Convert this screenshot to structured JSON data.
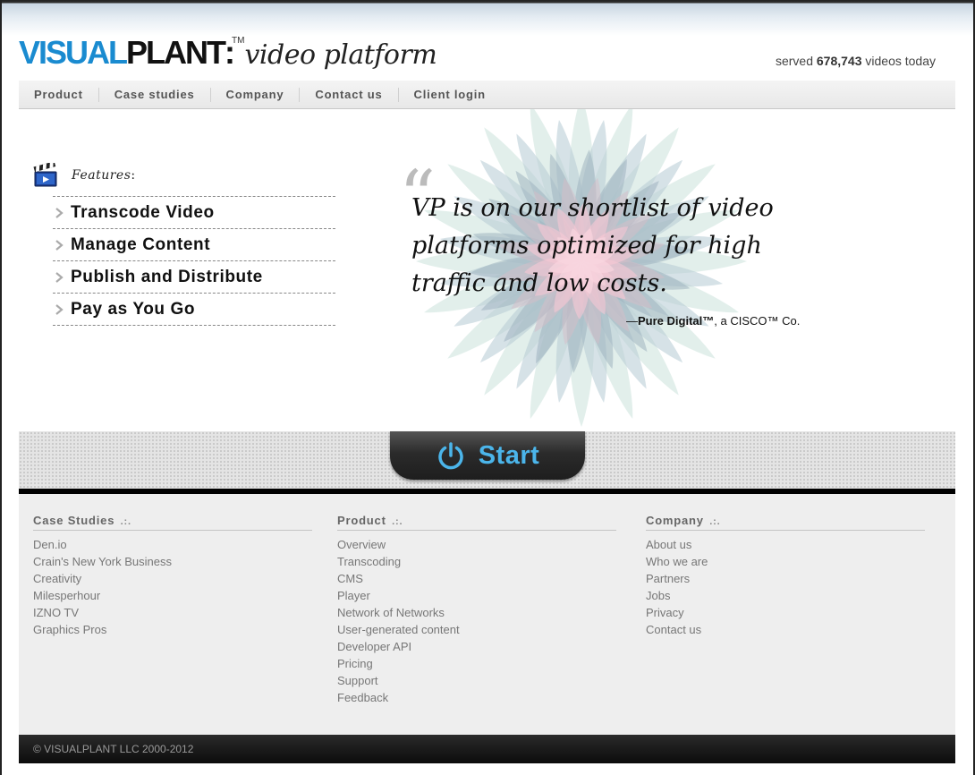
{
  "brand": {
    "visual": "VISUAL",
    "plant": "PLANT",
    "colon": ":",
    "tm": "TM",
    "tagline": "video platform",
    "colors": {
      "blue": "#1a8bd0",
      "dark": "#111111"
    }
  },
  "served": {
    "prefix": "served ",
    "count": "678,743",
    "suffix": " videos today"
  },
  "nav": {
    "items": [
      {
        "label": "Product"
      },
      {
        "label": "Case studies"
      },
      {
        "label": "Company"
      },
      {
        "label": "Contact us"
      },
      {
        "label": "Client login"
      }
    ]
  },
  "features": {
    "label": "Features",
    "label_suffix": ":",
    "icon": "clapperboard-icon",
    "items": [
      {
        "label": "Transcode Video"
      },
      {
        "label": "Manage Content"
      },
      {
        "label": "Publish and Distribute"
      },
      {
        "label": "Pay as You Go"
      }
    ]
  },
  "quote": {
    "open_mark": "“",
    "text": "VP is on our shortlist of video platforms optimized for high traffic and low costs.",
    "attribution_prefix": "—",
    "attribution_name": "Pure Digital™",
    "attribution_suffix": ", a CISCO™ Co."
  },
  "start": {
    "label": "Start",
    "icon": "power-icon",
    "color": "#4bb5ea"
  },
  "footer": {
    "columns": [
      {
        "heading": "Case Studies",
        "dots": ".:.",
        "links": [
          "Den.io",
          "Crain's New York Business",
          "Creativity",
          "Milesperhour",
          "IZNO TV",
          "Graphics Pros"
        ]
      },
      {
        "heading": "Product",
        "dots": ".:.",
        "links": [
          "Overview",
          "Transcoding",
          "CMS",
          "Player",
          "Network of Networks",
          "User-generated content",
          "Developer API",
          "Pricing",
          "Support",
          "Feedback"
        ]
      },
      {
        "heading": "Company",
        "dots": ".:.",
        "links": [
          "About us",
          "Who we are",
          "Partners",
          "Jobs",
          "Privacy",
          "Contact us"
        ]
      }
    ],
    "copyright": "© VISUALPLANT LLC 2000-2012"
  }
}
